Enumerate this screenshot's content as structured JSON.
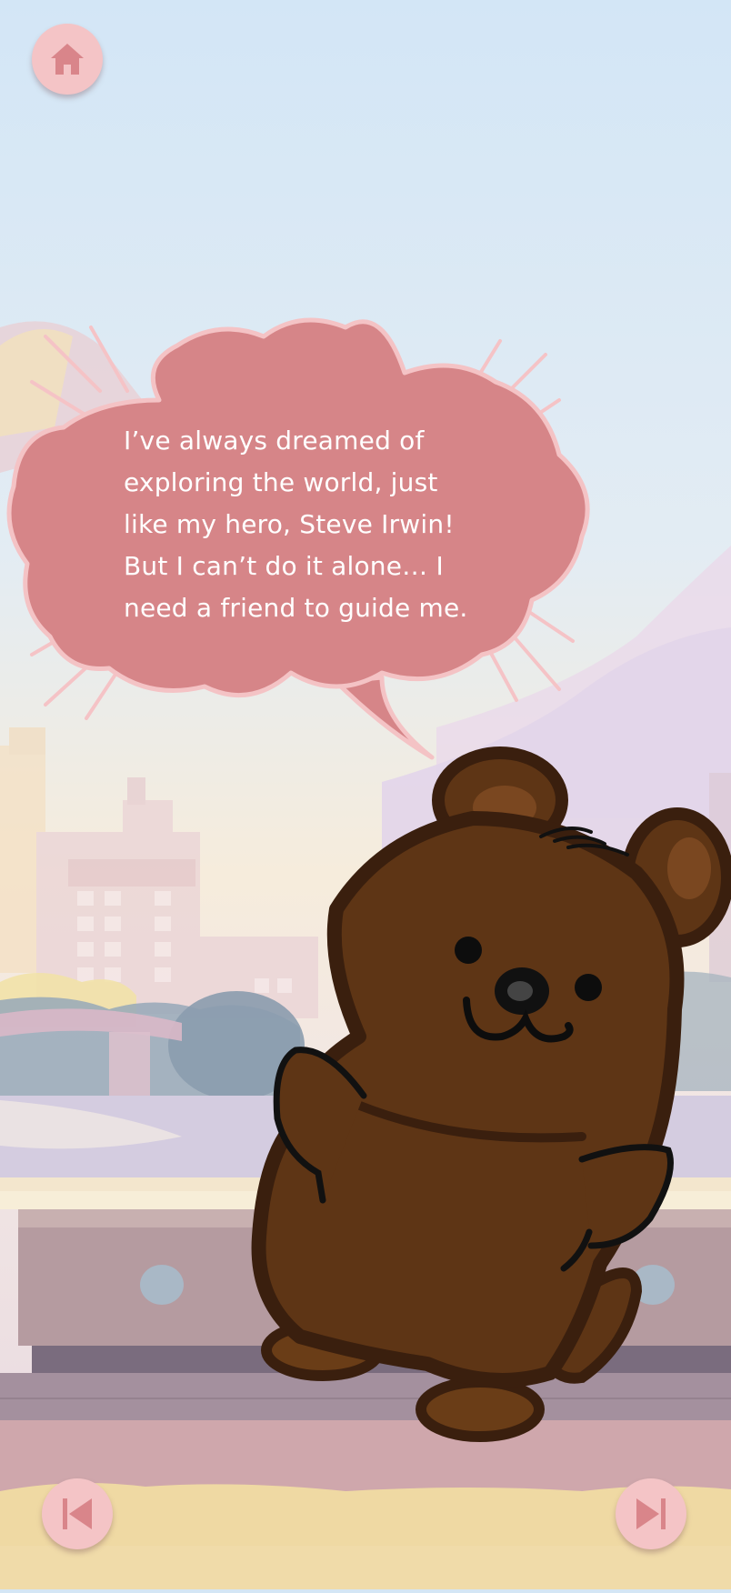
{
  "story": {
    "speech_lines": [
      "I’ve always dreamed of",
      "exploring the world, just",
      "like my hero, Steve Irwin!",
      "But I can’t do it alone… I",
      "need a friend to guide me."
    ]
  },
  "icons": {
    "home": "home-icon",
    "previous": "skip-previous-icon",
    "next": "skip-next-icon"
  },
  "colors": {
    "button_bg": "#f4c4c6",
    "button_icon": "#d9858a",
    "bubble_fill": "#d68588",
    "bubble_outline": "#f4c3c5",
    "bear_body": "#5e3515",
    "bear_outline": "#3a1f0e",
    "sky_top": "#d4e6f5",
    "ground": "#efd9a3"
  }
}
